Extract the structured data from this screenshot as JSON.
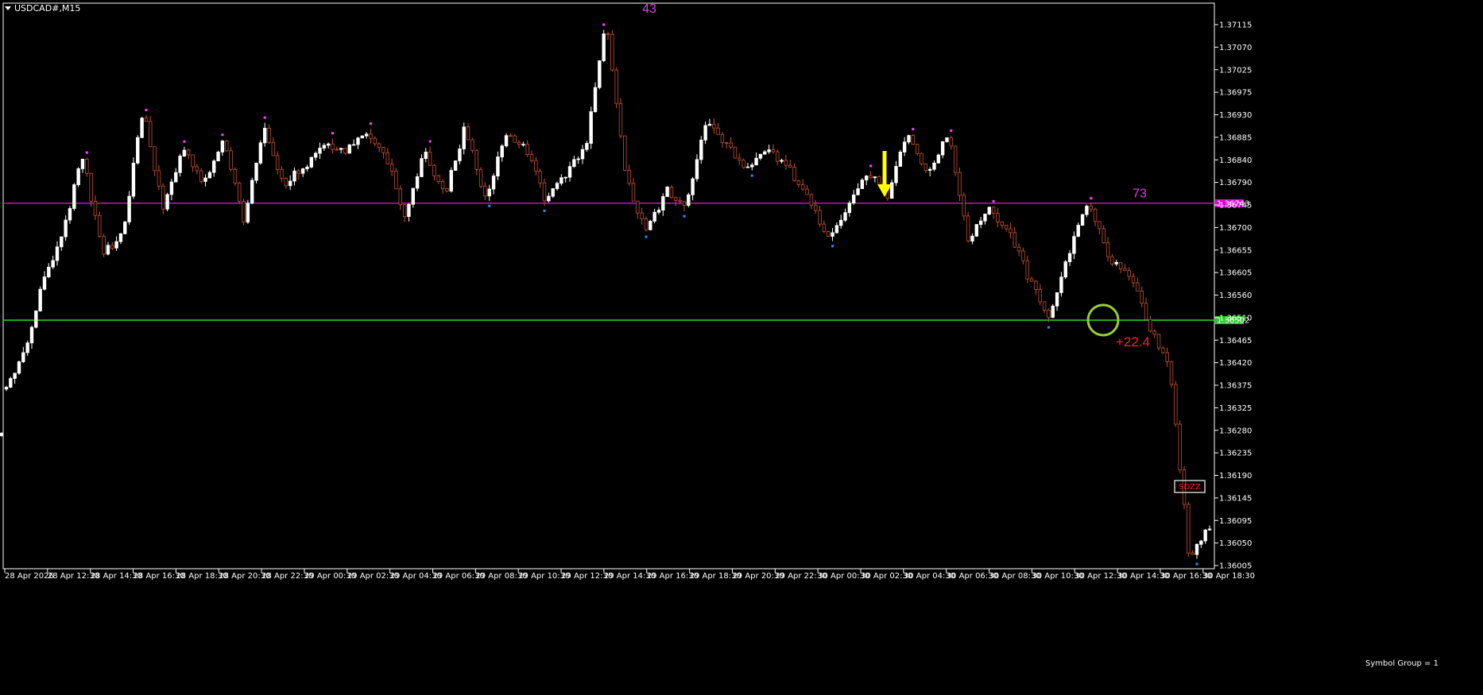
{
  "window": {
    "title": "USDCAD#,M15"
  },
  "colors": {
    "background": "#000000",
    "bull_candle": "#ffffff",
    "bear_candle": "#c8502a",
    "resistance_line": "#e000e0",
    "support_line": "#22cc22",
    "arrow": "#ffff00",
    "circle": "#9acd32",
    "profit_text": "#ff2020",
    "frame": "#ffffff",
    "label_blue": "#1e90ff",
    "label_magenta": "#ff40ff"
  },
  "chart_data": {
    "type": "candlestick",
    "symbol": "USDCAD#",
    "timeframe": "M15",
    "ylim": [
      1.3599,
      1.37155
    ],
    "y_ticks": [
      "1.37115",
      "1.37070",
      "1.37025",
      "1.36975",
      "1.36930",
      "1.36885",
      "1.36840",
      "1.36790",
      "1.36745",
      "1.36700",
      "1.36655",
      "1.36605",
      "1.36560",
      "1.36510",
      "1.36465",
      "1.36420",
      "1.36375",
      "1.36325",
      "1.36280",
      "1.36235",
      "1.36190",
      "1.36145",
      "1.36095",
      "1.36050",
      "1.36005"
    ],
    "x_ticks": [
      "28 Apr 2026",
      "28 Apr 12:30",
      "28 Apr 14:30",
      "28 Apr 16:30",
      "28 Apr 18:30",
      "28 Apr 20:30",
      "28 Apr 22:30",
      "29 Apr 00:30",
      "29 Apr 02:30",
      "29 Apr 04:30",
      "29 Apr 06:30",
      "29 Apr 08:30",
      "29 Apr 10:30",
      "29 Apr 12:30",
      "29 Apr 14:30",
      "29 Apr 16:30",
      "29 Apr 18:30",
      "29 Apr 20:30",
      "29 Apr 22:30",
      "30 Apr 00:30",
      "30 Apr 02:30",
      "30 Apr 04:30",
      "30 Apr 06:30",
      "30 Apr 08:30",
      "30 Apr 10:30",
      "30 Apr 12:30",
      "30 Apr 14:30",
      "30 Apr 16:30",
      "30 Apr 18:30"
    ],
    "pivots": [
      1.3636,
      1.3642,
      1.3658,
      1.3668,
      1.3684,
      1.3664,
      1.3668,
      1.3694,
      1.3673,
      1.3686,
      1.3678,
      1.3688,
      1.367,
      1.369,
      1.3678,
      1.3682,
      1.3686,
      1.3685,
      1.3689,
      1.3685,
      1.3672,
      1.3685,
      1.3676,
      1.369,
      1.3675,
      1.3688,
      1.3686,
      1.3675,
      1.368,
      1.3686,
      1.3712,
      1.368,
      1.3668,
      1.3677,
      1.3674,
      1.3691,
      1.3686,
      1.3681,
      1.3685,
      1.3682,
      1.3676,
      1.3667,
      1.3673,
      1.3681,
      1.3676,
      1.3689,
      1.368,
      1.3689,
      1.3667,
      1.3673,
      1.3669,
      1.3659,
      1.365,
      1.3664,
      1.3675,
      1.3663,
      1.366,
      1.3649,
      1.3641,
      1.3601,
      1.3608
    ],
    "resistance": {
      "price": 1.36743,
      "label": "1.36743"
    },
    "support": {
      "price": 1.36502,
      "label": "1.36502"
    },
    "peak_labels": [
      {
        "text": "43",
        "price": 1.37135
      },
      {
        "text": "73",
        "price": 1.36755
      }
    ],
    "annotations": {
      "profit": "+22.4",
      "box_label": "SDZZ",
      "symbol_group": "Symbol Group = 1"
    }
  }
}
